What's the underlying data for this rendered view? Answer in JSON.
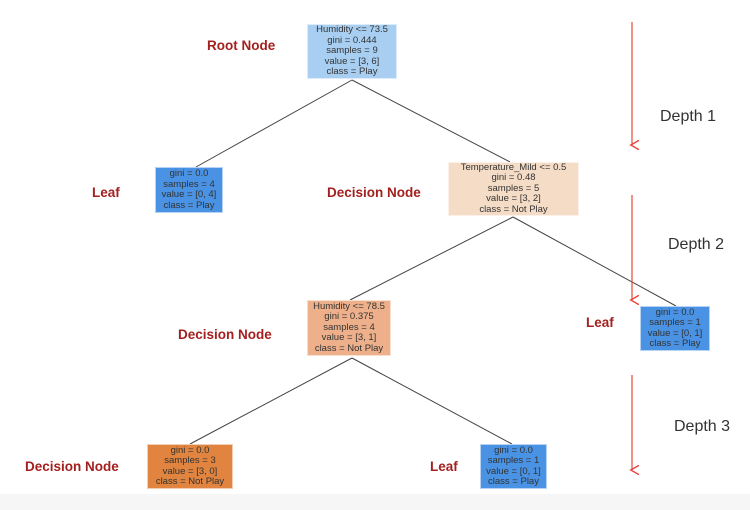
{
  "colors": {
    "label": "#a3201f",
    "arrow": "#e8453c",
    "play_light": "#a8cff2",
    "play": "#4a92e3",
    "notplay_light": "#f4dcc6",
    "notplay_mid": "#eeb08a",
    "notplay": "#e0843f"
  },
  "nodes": [
    {
      "id": "root",
      "lines": [
        "Humidity <= 73.5",
        "gini = 0.444",
        "samples = 9",
        "value = [3, 6]",
        "class = Play"
      ]
    },
    {
      "id": "leaf1",
      "lines": [
        "gini = 0.0",
        "samples = 4",
        "value = [0, 4]",
        "class = Play"
      ]
    },
    {
      "id": "dec1",
      "lines": [
        "Temperature_Mild <= 0.5",
        "gini = 0.48",
        "samples = 5",
        "value = [3, 2]",
        "class = Not Play"
      ]
    },
    {
      "id": "dec2",
      "lines": [
        "Humidity <= 78.5",
        "gini = 0.375",
        "samples = 4",
        "value = [3, 1]",
        "class = Not Play"
      ]
    },
    {
      "id": "leaf2",
      "lines": [
        "gini = 0.0",
        "samples = 1",
        "value = [0, 1]",
        "class = Play"
      ]
    },
    {
      "id": "leaf3",
      "lines": [
        "gini = 0.0",
        "samples = 3",
        "value = [3, 0]",
        "class = Not Play"
      ]
    },
    {
      "id": "leaf4",
      "lines": [
        "gini = 0.0",
        "samples = 1",
        "value = [0, 1]",
        "class = Play"
      ]
    }
  ],
  "labels": [
    "Root Node",
    "Leaf",
    "Decision Node",
    "Decision Node",
    "Leaf",
    "Decision Node",
    "Leaf"
  ],
  "depths": [
    "Depth 1",
    "Depth 2",
    "Depth 3"
  ]
}
